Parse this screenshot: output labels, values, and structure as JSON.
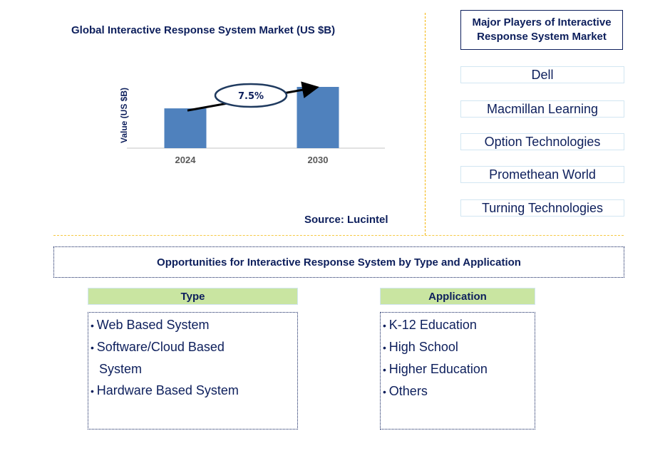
{
  "chart_data": {
    "type": "bar",
    "title": "Global Interactive Response System Market (US $B)",
    "xlabel": "",
    "ylabel": "Value (US $B)",
    "categories": [
      "2024",
      "2030"
    ],
    "values": [
      1.0,
      1.54
    ],
    "value_note": "relative values; no y-axis ticks shown",
    "annotation": {
      "label": "7.5%",
      "type": "CAGR arrow from 2024 to 2030"
    },
    "colors": {
      "bar": "#4f81bd",
      "text": "#0d1f5c",
      "tick": "#595959"
    },
    "grid": false
  },
  "source": "Source: Lucintel",
  "players": {
    "title": "Major Players of Interactive Response System Market",
    "items": [
      "Dell",
      "Macmillan Learning",
      "Option Technologies",
      "Promethean World",
      "Turning Technologies"
    ]
  },
  "opportunities": {
    "title": "Opportunities for Interactive Response System by Type and Application",
    "type": {
      "header": "Type",
      "items": [
        "Web Based System",
        "Software/Cloud Based System",
        "Hardware Based System"
      ]
    },
    "application": {
      "header": "Application",
      "items": [
        "K-12 Education",
        "High School",
        "Higher Education",
        "Others"
      ]
    }
  }
}
